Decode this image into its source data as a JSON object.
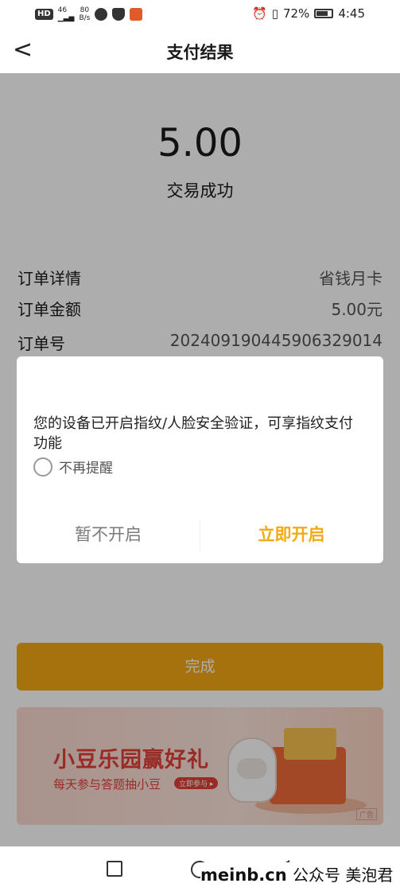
{
  "status_bar": {
    "hd": "HD",
    "network": "46",
    "speed_value": "80",
    "speed_unit": "B/s",
    "battery": "72%",
    "time": "4:45"
  },
  "nav": {
    "back_glyph": "<",
    "title": "支付结果"
  },
  "payment": {
    "amount": "5.00",
    "status": "交易成功"
  },
  "order": {
    "rows": [
      {
        "key": "订单详情",
        "value": "省钱月卡"
      },
      {
        "key": "订单金额",
        "value": "5.00元"
      },
      {
        "key": "订单号",
        "value": "20240919044590632901​4"
      }
    ]
  },
  "done_button": "完成",
  "banner": {
    "title": "小豆乐园赢好礼",
    "subtitle": "每天参与答题抽小豆",
    "cta": "立即参与 ▸",
    "ad_tag": "广告"
  },
  "dialog": {
    "message": "您的设备已开启指纹/人脸安全验证，可享指纹支付功能",
    "checkbox_label": "不再提醒",
    "cancel": "暂不开启",
    "confirm": "立即开启"
  },
  "watermark": {
    "site": "meinb.cn",
    "account": "公众号 美泡君"
  },
  "colors": {
    "accent": "#f3a914",
    "banner_red": "#e2403a",
    "overlay": "rgba(0,0,0,0.32)"
  },
  "icons": [
    "wechat-icon",
    "shield-icon",
    "app-icon",
    "alarm-icon",
    "vibrate-icon",
    "battery-icon",
    "back-icon",
    "recent-apps-icon",
    "home-icon",
    "system-back-icon"
  ]
}
